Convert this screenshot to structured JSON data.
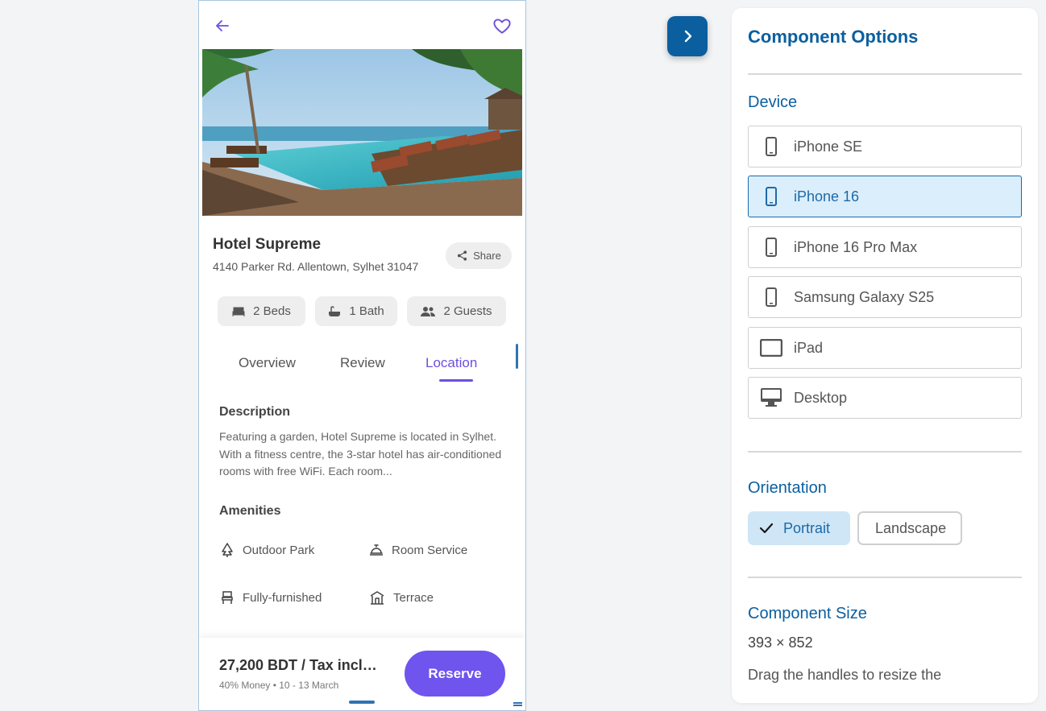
{
  "phone": {
    "hotel": {
      "name": "Hotel Supreme",
      "address": "4140 Parker Rd. Allentown, Sylhet 31047",
      "share_label": "Share"
    },
    "chips": [
      {
        "label": "2 Beds",
        "icon": "bed-icon"
      },
      {
        "label": "1 Bath",
        "icon": "bathtub-icon"
      },
      {
        "label": "2 Guests",
        "icon": "guests-icon"
      }
    ],
    "tabs": [
      {
        "label": "Overview",
        "active": false
      },
      {
        "label": "Review",
        "active": false
      },
      {
        "label": "Location",
        "active": true
      }
    ],
    "description": {
      "heading": "Description",
      "text": "Featuring a garden, Hotel Supreme is located in Sylhet. With a fitness centre, the 3-star hotel has air-conditioned rooms with free WiFi. Each room..."
    },
    "amenities": {
      "heading": "Amenities",
      "items": [
        {
          "label": "Outdoor Park",
          "icon": "tree-icon"
        },
        {
          "label": "Room Service",
          "icon": "room-service-icon"
        },
        {
          "label": "Fully-furnished",
          "icon": "chair-icon"
        },
        {
          "label": "Terrace",
          "icon": "terrace-icon"
        }
      ]
    },
    "booking": {
      "price": "27,200 BDT / Tax included",
      "details": "40% Money • 10 - 13 March",
      "reserve_label": "Reserve"
    }
  },
  "panel": {
    "title": "Component Options",
    "device_heading": "Device",
    "devices": [
      {
        "label": "iPhone SE",
        "icon": "phone-icon",
        "selected": false
      },
      {
        "label": "iPhone 16",
        "icon": "phone-icon",
        "selected": true
      },
      {
        "label": "iPhone 16 Pro Max",
        "icon": "phone-icon",
        "selected": false
      },
      {
        "label": "Samsung Galaxy S25",
        "icon": "phone-icon",
        "selected": false
      },
      {
        "label": "iPad",
        "icon": "tablet-icon",
        "selected": false
      },
      {
        "label": "Desktop",
        "icon": "desktop-icon",
        "selected": false
      }
    ],
    "orientation_heading": "Orientation",
    "orientations": [
      {
        "label": "Portrait",
        "selected": true
      },
      {
        "label": "Landscape",
        "selected": false
      }
    ],
    "size_heading": "Component Size",
    "size_value": "393 × 852",
    "size_help": "Drag the handles to resize the"
  },
  "colors": {
    "accent_purple": "#6f55ee",
    "panel_blue": "#0b5f9f",
    "selected_bg": "#dbeefb"
  }
}
